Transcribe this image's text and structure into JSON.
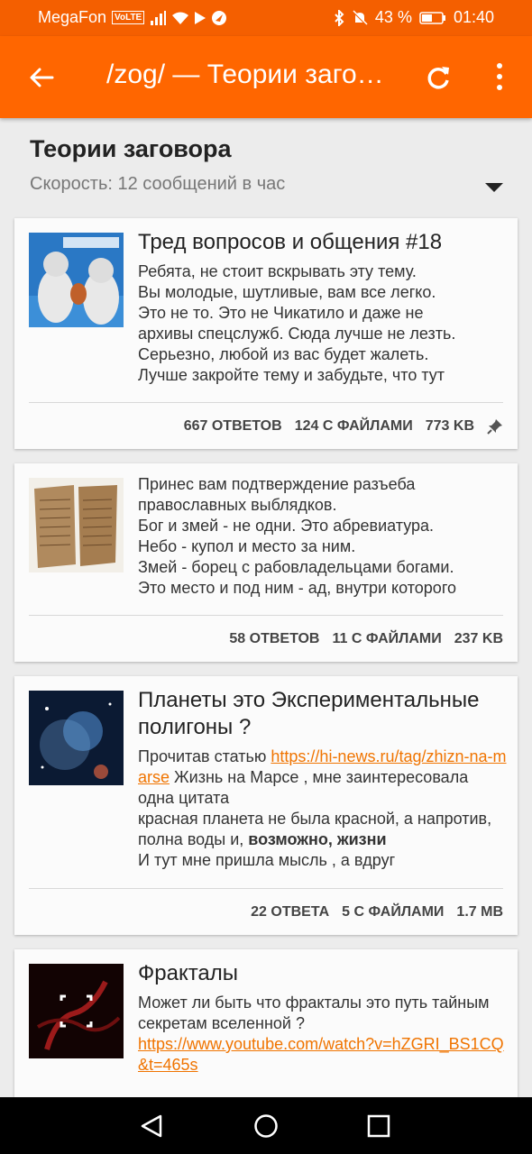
{
  "status": {
    "carrier": "MegaFon",
    "volte": "VoLTE",
    "battery": "43 %",
    "time": "01:40"
  },
  "toolbar": {
    "title": "/zog/ — Теории заговора"
  },
  "board": {
    "title": "Теории заговора",
    "speed": "Скорость: 12 сообщений в час"
  },
  "threads": [
    {
      "subject": "Тред вопросов и общения #18",
      "lines": [
        "Ребята, не стоит вскрывать эту тему.",
        "Вы молодые, шутливые, вам все легко.",
        "Это не то. Это не Чикатило и даже не",
        "архивы спецслужб. Сюда лучше не лезть.",
        "Серьезно, любой из вас будет жалеть.",
        "Лучше закройте тему и забудьте, что тут"
      ],
      "replies": "667 ОТВЕТОВ",
      "files": "124 С ФАЙЛАМИ",
      "size": "773 KB"
    },
    {
      "lines": [
        "Принес вам подтверждение разъеба",
        "православных выблядков.",
        "Бог и змей - не одни. Это абревиатура.",
        "Небо - купол и место за ним.",
        "Змей - борец с рабовладельцами богами.",
        "Это место и под ним - ад, внутри которого"
      ],
      "replies": "58 ОТВЕТОВ",
      "files": "11 С ФАЙЛАМИ",
      "size": "237 KB"
    },
    {
      "subject": "Планеты это Экспериментальные полигоны ?",
      "body_prefix": "Прочитав статью ",
      "link": "https://hi-news.ru/tag/zhizn-na-marse",
      "body_suffix": " Жизнь на Марсе , мне заинтересовала одна цитата",
      "line2": "красная планета не была красной, а напротив, полна воды и, ",
      "line2_bold": "возможно, жизни",
      "line3": "И тут мне пришла мысль , а вдруг",
      "replies": "22 ОТВЕТА",
      "files": "5 С ФАЙЛАМИ",
      "size": "1.7 MB"
    },
    {
      "subject": "Фракталы",
      "body": "Может ли быть что фракталы это путь тайным секретам вселенной ?",
      "link": "https://www.youtube.com/watch?v=hZGRI_BS1CQ&t=465s"
    }
  ]
}
